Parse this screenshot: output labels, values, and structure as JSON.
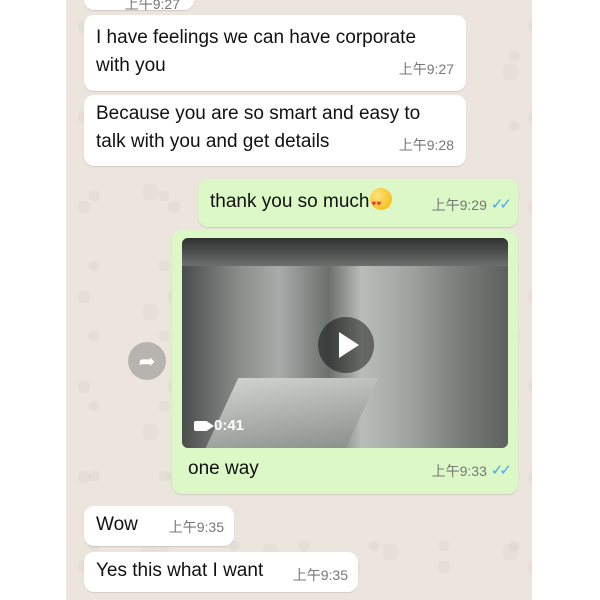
{
  "messages": [
    {
      "id": "m0",
      "direction": "in",
      "text": "",
      "time": "上午9:27"
    },
    {
      "id": "m1",
      "direction": "in",
      "text": "I have feelings we can have corporate\nwith you",
      "time": "上午9:27"
    },
    {
      "id": "m2",
      "direction": "in",
      "text": "Because you are so smart and easy to\ntalk with you and get details",
      "time": "上午9:28"
    },
    {
      "id": "m3",
      "direction": "out",
      "text": "thank you so much",
      "emoji": "smiling-face-with-hearts",
      "time": "上午9:29",
      "status": "read"
    },
    {
      "id": "m4",
      "direction": "out",
      "type": "video",
      "duration": "0:41",
      "caption": "one way",
      "time": "上午9:33",
      "status": "read"
    },
    {
      "id": "m5",
      "direction": "in",
      "text": "Wow",
      "time": "上午9:35"
    },
    {
      "id": "m6",
      "direction": "in",
      "text": "Yes this what I want",
      "time": "上午9:35"
    }
  ],
  "ticks_glyph": "✓✓",
  "colors": {
    "chat_bg": "#ece5dd",
    "incoming_bubble": "#ffffff",
    "outgoing_bubble": "#dcf8c6",
    "read_ticks": "#4fa3e8"
  }
}
